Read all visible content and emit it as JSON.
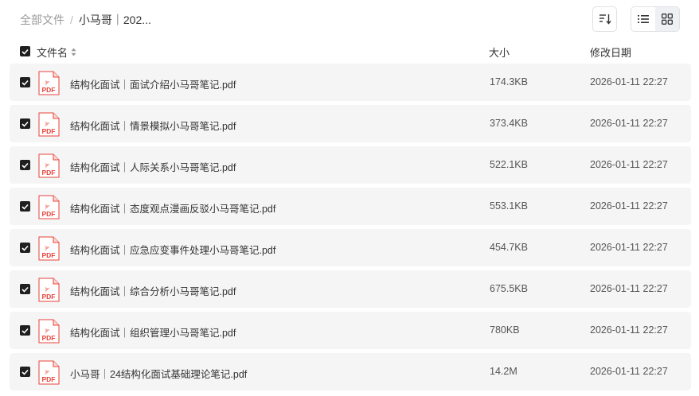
{
  "breadcrumb": {
    "root": "全部文件",
    "separator": "/",
    "current": "小马哥｜202..."
  },
  "toolbar": {
    "sort_icon": "sort-descending-icon",
    "list_view_icon": "list-view-icon",
    "grid_view_icon": "grid-view-icon",
    "active_view": "list"
  },
  "table": {
    "headers": {
      "name": "文件名",
      "size": "大小",
      "modified": "修改日期"
    },
    "rows": [
      {
        "name": "结构化面试｜面试介绍小马哥笔记.pdf",
        "size": "174.3KB",
        "date": "2026-01-11 22:27",
        "type": "PDF",
        "checked": true
      },
      {
        "name": "结构化面试｜情景模拟小马哥笔记.pdf",
        "size": "373.4KB",
        "date": "2026-01-11 22:27",
        "type": "PDF",
        "checked": true
      },
      {
        "name": "结构化面试｜人际关系小马哥笔记.pdf",
        "size": "522.1KB",
        "date": "2026-01-11 22:27",
        "type": "PDF",
        "checked": true
      },
      {
        "name": "结构化面试｜态度观点漫画反驳小马哥笔记.pdf",
        "size": "553.1KB",
        "date": "2026-01-11 22:27",
        "type": "PDF",
        "checked": true
      },
      {
        "name": "结构化面试｜应急应变事件处理小马哥笔记.pdf",
        "size": "454.7KB",
        "date": "2026-01-11 22:27",
        "type": "PDF",
        "checked": true
      },
      {
        "name": "结构化面试｜综合分析小马哥笔记.pdf",
        "size": "675.5KB",
        "date": "2026-01-11 22:27",
        "type": "PDF",
        "checked": true
      },
      {
        "name": "结构化面试｜组织管理小马哥笔记.pdf",
        "size": "780KB",
        "date": "2026-01-11 22:27",
        "type": "PDF",
        "checked": true
      },
      {
        "name": "小马哥｜24结构化面试基础理论笔记.pdf",
        "size": "14.2M",
        "date": "2026-01-11 22:27",
        "type": "PDF",
        "checked": true
      }
    ]
  },
  "colors": {
    "row_bg": "#f5f5f6",
    "pdf_red": "#e8433a",
    "checkbox": "#1f1f1f"
  }
}
